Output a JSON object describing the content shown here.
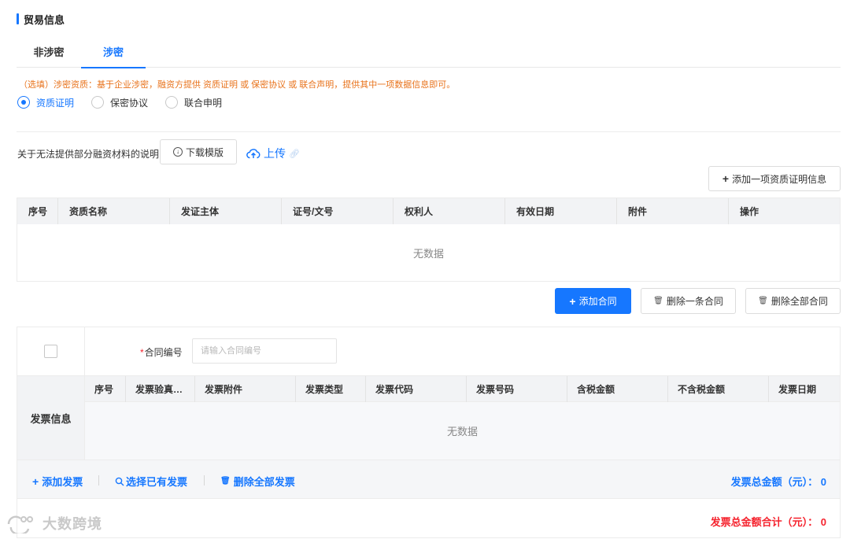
{
  "section": {
    "title": "贸易信息"
  },
  "tabs": [
    {
      "label": "非涉密"
    },
    {
      "label": "涉密",
      "active": true
    }
  ],
  "tip": "（选填）涉密资质：基于企业涉密，融资方提供 资质证明 或 保密协议 或 联合声明，提供其中一项数据信息即可。",
  "radios": [
    {
      "label": "资质证明",
      "checked": true
    },
    {
      "label": "保密协议",
      "checked": false
    },
    {
      "label": "联合申明",
      "checked": false
    }
  ],
  "material": {
    "label": "关于无法提供部分融资材料的说明",
    "download_label": "下载模版",
    "upload_label": "上传"
  },
  "cert": {
    "add_label": "添加一项资质证明信息",
    "columns": [
      "序号",
      "资质名称",
      "发证主体",
      "证号/文号",
      "权利人",
      "有效日期",
      "附件",
      "操作"
    ],
    "empty_text": "无数据"
  },
  "contract": {
    "add_label": "添加合同",
    "delete_one_label": "删除一条合同",
    "delete_all_label": "删除全部合同",
    "number_label": "合同编号",
    "number_value": "",
    "number_placeholder": "请输入合同编号"
  },
  "invoice": {
    "section_label": "发票信息",
    "columns": [
      "序号",
      "发票验真…",
      "发票附件",
      "发票类型",
      "发票代码",
      "发票号码",
      "含税金额",
      "不含税金额",
      "发票日期"
    ],
    "empty_text": "无数据",
    "add_label": "添加发票",
    "select_label": "选择已有发票",
    "delete_all_label": "删除全部发票",
    "total_text": "发票总金额（元）： 0",
    "grand_total_text": "发票总金额合计（元）： 0"
  },
  "watermark": {
    "text": "大数跨境"
  },
  "colors": {
    "accent": "#1677ff",
    "warning": "#e8731c",
    "danger": "#f5222d"
  }
}
